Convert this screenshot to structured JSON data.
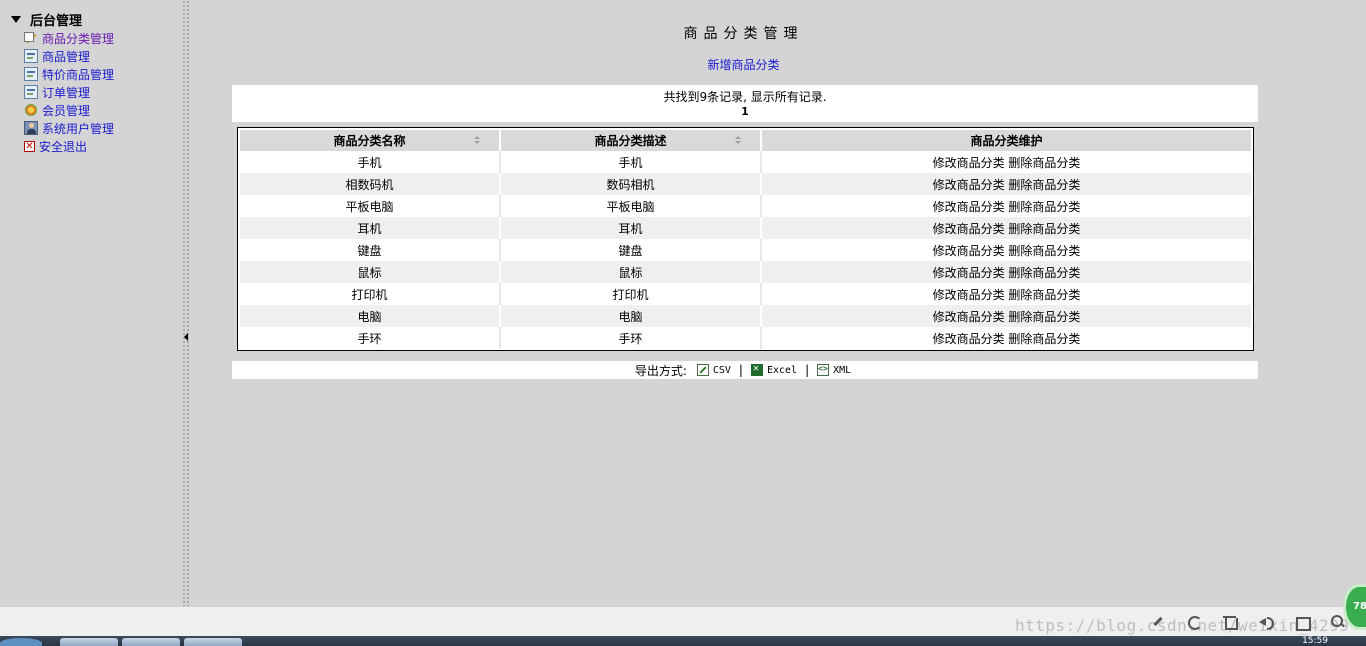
{
  "sidebar": {
    "root_label": "后台管理",
    "items": [
      {
        "label": "商品分类管理",
        "icon": "edit-icon",
        "visited": true
      },
      {
        "label": "商品管理",
        "icon": "product-icon",
        "visited": false
      },
      {
        "label": "特价商品管理",
        "icon": "sale-icon",
        "visited": false
      },
      {
        "label": "订单管理",
        "icon": "order-icon",
        "visited": false
      },
      {
        "label": "会员管理",
        "icon": "member-icon",
        "visited": false
      },
      {
        "label": "系统用户管理",
        "icon": "user-icon",
        "visited": false
      },
      {
        "label": "安全退出",
        "icon": "exit-icon",
        "visited": false
      }
    ]
  },
  "main": {
    "title": "商品分类管理",
    "add_link": "新增商品分类",
    "records_text": "共找到9条记录, 显示所有记录.",
    "page_number": "1",
    "table": {
      "headers": [
        "商品分类名称",
        "商品分类描述",
        "商品分类维护"
      ],
      "rows": [
        {
          "name": "手机",
          "desc": "手机"
        },
        {
          "name": "相数码机",
          "desc": "数码相机"
        },
        {
          "name": "平板电脑",
          "desc": "平板电脑"
        },
        {
          "name": "耳机",
          "desc": "耳机"
        },
        {
          "name": "键盘",
          "desc": "键盘"
        },
        {
          "name": "鼠标",
          "desc": "鼠标"
        },
        {
          "name": "打印机",
          "desc": "打印机"
        },
        {
          "name": "电脑",
          "desc": "电脑"
        },
        {
          "name": "手环",
          "desc": "手环"
        }
      ],
      "edit_label": "修改商品分类",
      "delete_label": "删除商品分类"
    },
    "export": {
      "label": "导出方式:",
      "formats": [
        "CSV",
        "Excel",
        "XML"
      ],
      "separator": "|"
    }
  },
  "statusbar": {
    "watermark": "https://blog.csdn.net/weixin_4299",
    "badge": "78",
    "clock": "15:59"
  },
  "colors": {
    "background": "#d4d4d4",
    "link": "#1b1bd0",
    "visited_link": "#6a1bb0",
    "header_bg": "#d9d9d9",
    "row_alt": "#efefef"
  }
}
